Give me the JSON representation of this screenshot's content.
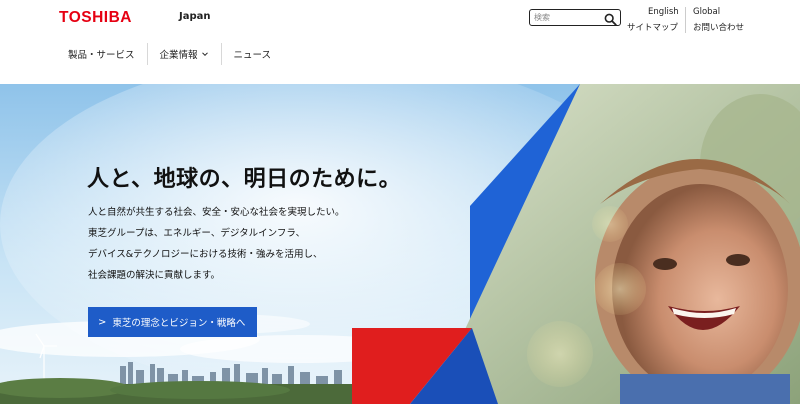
{
  "header": {
    "logo": "TOSHIBA",
    "region": "Japan",
    "search": {
      "placeholder": "検索"
    },
    "utility": {
      "english": "English",
      "global": "Global",
      "sitemap": "サイトマップ",
      "contact": "お問い合わせ"
    }
  },
  "nav": {
    "items": [
      {
        "label": "製品・サービス"
      },
      {
        "label": "企業情報"
      },
      {
        "label": "ニュース"
      }
    ]
  },
  "hero": {
    "headline": "人と、地球の、明日のために。",
    "body": [
      "人と自然が共生する社会、安全・安心な社会を実現したい。",
      "東芝グループは、エネルギー、デジタルインフラ、",
      "デバイス&テクノロジーにおける技術・強みを活用し、",
      "社会課題の解決に貢献します。"
    ],
    "cta": {
      "arrow": ">",
      "label": "東芝の理念とビジョン・戦略へ"
    }
  },
  "colors": {
    "brand": "#e60012",
    "accent_blue": "#1e5cc8",
    "red_triangle": "#e01e1e"
  },
  "icons": [
    "search-icon",
    "chevron-down-icon",
    "arrow-right-icon"
  ]
}
